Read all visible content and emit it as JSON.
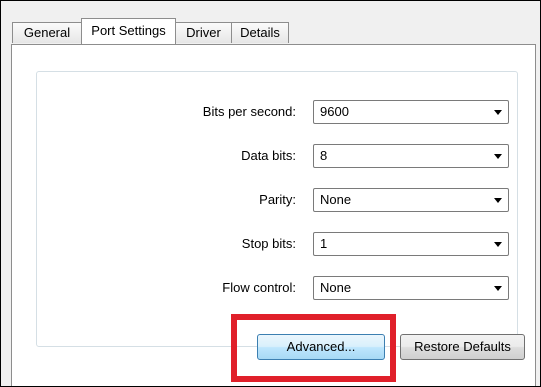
{
  "tabs": [
    {
      "label": "General",
      "active": false
    },
    {
      "label": "Port Settings",
      "active": true
    },
    {
      "label": "Driver",
      "active": false
    },
    {
      "label": "Details",
      "active": false
    }
  ],
  "fields": {
    "bits_per_second": {
      "label": "Bits per second:",
      "value": "9600"
    },
    "data_bits": {
      "label": "Data bits:",
      "value": "8"
    },
    "parity": {
      "label": "Parity:",
      "value": "None"
    },
    "stop_bits": {
      "label": "Stop bits:",
      "value": "1"
    },
    "flow_control": {
      "label": "Flow control:",
      "value": "None"
    }
  },
  "buttons": {
    "advanced": "Advanced...",
    "restore_defaults": "Restore Defaults"
  },
  "colors": {
    "highlight": "#e0202a",
    "focused_button": "#bee6fd"
  }
}
